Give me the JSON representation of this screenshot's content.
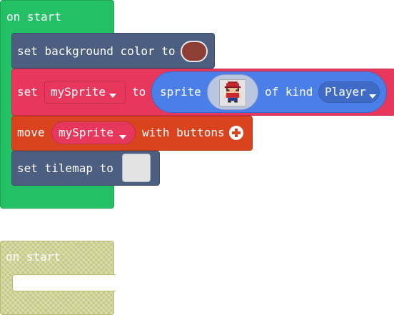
{
  "block1": {
    "hat_label": "on start",
    "bg_block": {
      "label": "set background color to",
      "color": "#8e3f35"
    },
    "set_block": {
      "set_label": "set",
      "var_name": "mySprite",
      "to_label": "to",
      "sprite_label": "sprite",
      "kind_label": "of kind",
      "kind_value": "Player"
    },
    "move_block": {
      "move_label": "move",
      "var_name": "mySprite",
      "with_label": "with buttons",
      "plus_icon": "+"
    },
    "tilemap_block": {
      "label": "set tilemap to"
    }
  },
  "block2": {
    "hat_label": "on start"
  },
  "colors": {
    "event": "#23c065",
    "scene": "#4c5f80",
    "sprites": "#e8375c",
    "controller": "#d9441f",
    "sprite_pill": "#4a7ee8",
    "disabled": "#d3d38a"
  }
}
